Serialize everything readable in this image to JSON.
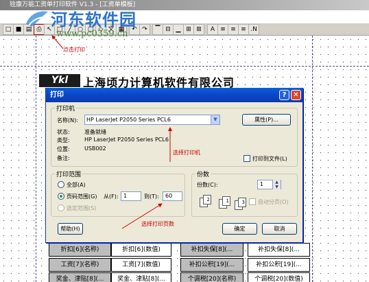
{
  "app": {
    "title": "铨康万能工资单打印软件 V1.3 - [工资单模板]"
  },
  "watermark": {
    "text": "河东软件园",
    "url": "www.pc0359.cn"
  },
  "toolbar": {
    "buttons": [
      {
        "name": "new-icon",
        "glyph": "□"
      },
      {
        "name": "save-icon",
        "glyph": "■"
      },
      {
        "name": "print-preview-icon",
        "glyph": "▤"
      },
      {
        "name": "print-icon",
        "glyph": "⎙"
      },
      {
        "name": "cursor-icon",
        "glyph": "↖"
      },
      {
        "name": "rectangle-icon",
        "glyph": "□"
      },
      {
        "name": "line-icon",
        "glyph": "╱"
      },
      {
        "name": "ellipse-icon",
        "glyph": "○"
      },
      {
        "name": "rounded-rect-icon",
        "glyph": "▢"
      },
      {
        "name": "shape-icon",
        "glyph": "◇"
      },
      {
        "name": "text-label",
        "glyph": "文"
      },
      {
        "name": "image-icon",
        "glyph": "▦"
      },
      {
        "name": "undo-icon",
        "glyph": "↶"
      },
      {
        "name": "redo-icon",
        "glyph": "↷"
      },
      {
        "name": "align-top-icon",
        "glyph": "▔"
      },
      {
        "name": "align-middle-icon",
        "glyph": "⊟"
      },
      {
        "name": "align-bottom-icon",
        "glyph": "▁"
      },
      {
        "name": "distribute-h-icon",
        "glyph": "⊞"
      },
      {
        "name": "table-icon",
        "glyph": "⊞"
      },
      {
        "name": "font-icon",
        "glyph": "A"
      },
      {
        "name": "align-left-icon",
        "glyph": "≡"
      },
      {
        "name": "align-center-icon",
        "glyph": "≡"
      },
      {
        "name": "align-right-icon",
        "glyph": "≡"
      },
      {
        "name": "number-format-icon",
        "glyph": ".N"
      }
    ]
  },
  "annotations": {
    "click_print": "点击打印",
    "select_printer": "选择打印机",
    "select_pages": "选择打印页数"
  },
  "company": {
    "logo_text": "Ykl",
    "name": "上海顷力计算机软件有限公司"
  },
  "table": {
    "rows": [
      [
        "折扣[6](名称)",
        "折扣[6](数值)",
        "补扣失保[8](...",
        "补扣失保[8](..."
      ],
      [
        "工资[7](名称)",
        "工资[7](数值)",
        "补扣公积[19](...",
        "补扣公积[19](..."
      ],
      [
        "奖金、津贴[8](...",
        "奖金、津贴[8](...",
        "个调税[20](名称)",
        "个调税[20](数值)"
      ]
    ]
  },
  "dialog": {
    "title": "打印",
    "help_glyph": "?",
    "close_glyph": "✕",
    "printer_group": {
      "label": "打印机",
      "name_label": "名称(N):",
      "name_value": "HP LaserJet P2050 Series PCL6",
      "properties_button": "属性(P)...",
      "status_label": "状态:",
      "status_value": "准备就绪",
      "type_label": "类型:",
      "type_value": "HP LaserJet P2050 Series PCL6",
      "location_label": "位置:",
      "location_value": "USB002",
      "comment_label": "备注:",
      "print_to_file": "打印到文件(L)"
    },
    "range_group": {
      "label": "打印范围",
      "all": "全部(A)",
      "pages": "页码范围(G)",
      "from_label": "从(F):",
      "from_value": "1",
      "to_label": "到(T):",
      "to_value": "60",
      "selection": "选定范围(S)"
    },
    "copies_group": {
      "label": "份数",
      "copies_label": "份数(C):",
      "copies_value": "1",
      "collate": "自动分页(O)",
      "collate_pages": [
        "1",
        "2",
        "3",
        "1",
        "2",
        "3"
      ]
    },
    "buttons": {
      "help": "帮助(H)",
      "ok": "确定",
      "cancel": "取消"
    }
  }
}
